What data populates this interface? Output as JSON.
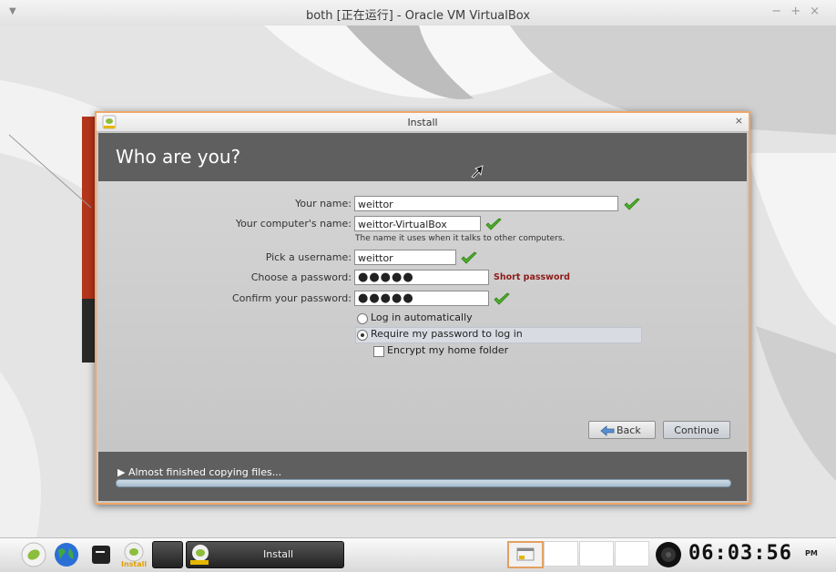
{
  "host_window": {
    "title": "both [正在运行] - Oracle VM VirtualBox",
    "controls": [
      "−",
      "+",
      "×"
    ]
  },
  "installer": {
    "window_title": "Install",
    "close_label": "×",
    "heading": "Who are you?",
    "form": {
      "your_name": {
        "label": "Your name:",
        "value": "weittor"
      },
      "computer_name": {
        "label": "Your computer's name:",
        "value": "weittor-VirtualBox",
        "hint": "The name it uses when it talks to other computers."
      },
      "username": {
        "label": "Pick a username:",
        "value": "weittor"
      },
      "password": {
        "label": "Choose a password:",
        "value": "●●●●●",
        "strength": "Short password"
      },
      "confirm_password": {
        "label": "Confirm your password:",
        "value": "●●●●●"
      }
    },
    "login_options": {
      "auto_login": {
        "label": "Log in automatically",
        "selected": false
      },
      "require_password": {
        "label": "Require my password to log in",
        "selected": true
      },
      "encrypt_home": {
        "label": "Encrypt my home folder",
        "checked": false
      }
    },
    "buttons": {
      "back": "Back",
      "continue": "Continue"
    },
    "progress": {
      "text": "▶ Almost finished copying files...",
      "fraction": 1.0
    }
  },
  "taskbar": {
    "launchers": [
      "leaf-icon",
      "globe-icon",
      "terminal-icon",
      "install-icon"
    ],
    "install_label": "Install",
    "task_label": "Install",
    "clock": "06:03:56",
    "ampm": "PM"
  },
  "colors": {
    "accent_border": "#f0a76a",
    "header_bg": "#5f5f5f",
    "check_green": "#4caf2a",
    "short_password_red": "#8e1b1b"
  }
}
